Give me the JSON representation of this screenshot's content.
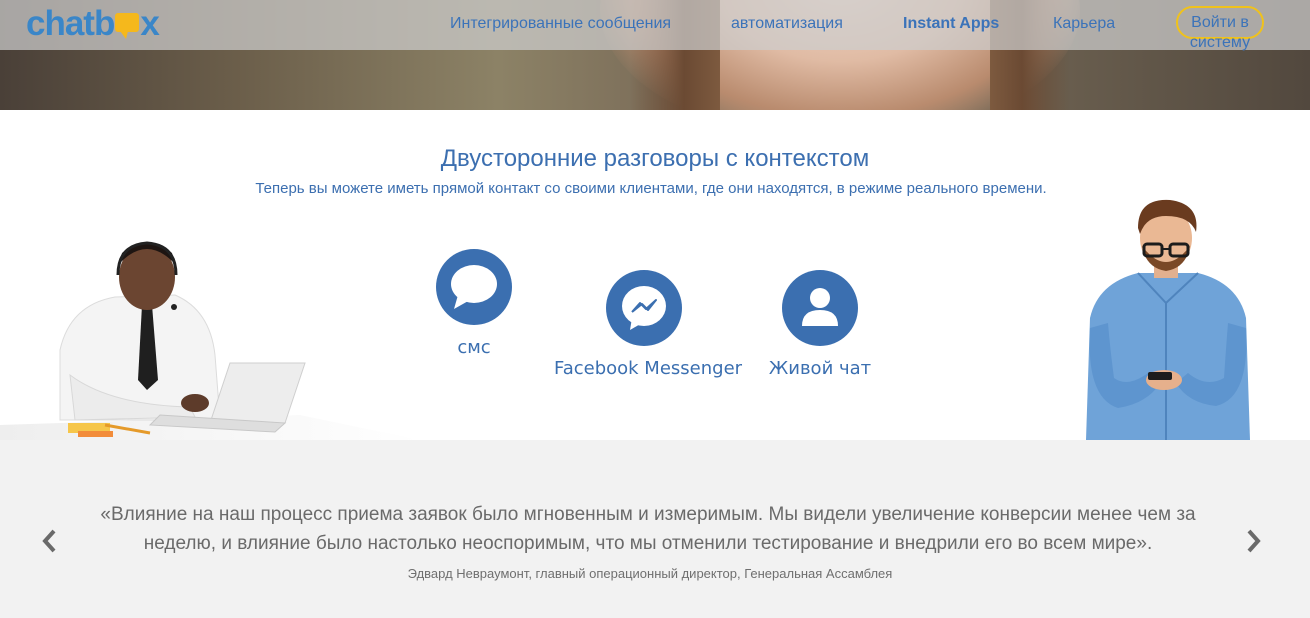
{
  "header": {
    "logo_prefix": "chatb",
    "logo_suffix": "x",
    "nav": [
      {
        "label": "Интегрированные сообщения"
      },
      {
        "label": "автоматизация"
      },
      {
        "label": "Instant Apps"
      },
      {
        "label": "Карьера"
      }
    ],
    "login_label": "Войти в систему"
  },
  "main": {
    "title": "Двусторонние разговоры с контекстом",
    "subtitle": "Теперь вы можете иметь прямой контакт со своими клиентами, где они находятся, в режиме реального времени.",
    "channels": [
      {
        "label": "смс",
        "icon": "chat-bubble-icon"
      },
      {
        "label": "Facebook Messenger",
        "icon": "messenger-icon"
      },
      {
        "label": "Живой чат",
        "icon": "user-icon"
      }
    ]
  },
  "testimonial": {
    "quote": "«Влияние на наш процесс приема заявок было мгновенным и измеримым. Мы видели увеличение конверсии менее чем за неделю, и влияние было настолько неоспоримым, что мы отменили тестирование и внедрили его во всем мире».",
    "author": "Эдвард Невраумонт, главный операционный директор, Генеральная Ассамблея"
  },
  "colors": {
    "brand_blue": "#3b6fb0",
    "accent_yellow": "#f0c21b",
    "testimonial_bg": "#f2f2f2"
  }
}
